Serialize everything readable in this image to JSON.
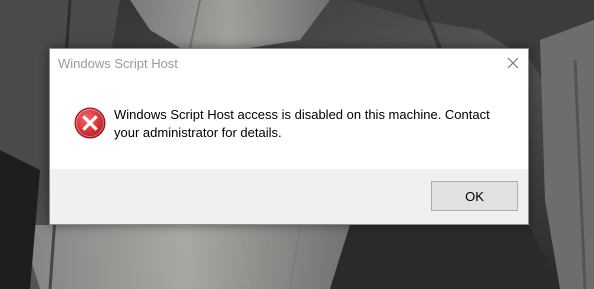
{
  "dialog": {
    "title": "Windows Script Host",
    "message": "Windows Script Host access is disabled on this machine. Contact your administrator for details.",
    "ok_label": "OK",
    "icon": "error-icon",
    "close_icon": "close-icon"
  },
  "colors": {
    "error_red": "#d9343a",
    "footer_bg": "#f0f0f0",
    "button_bg": "#e1e1e1",
    "title_gray": "#9a9a9a"
  }
}
